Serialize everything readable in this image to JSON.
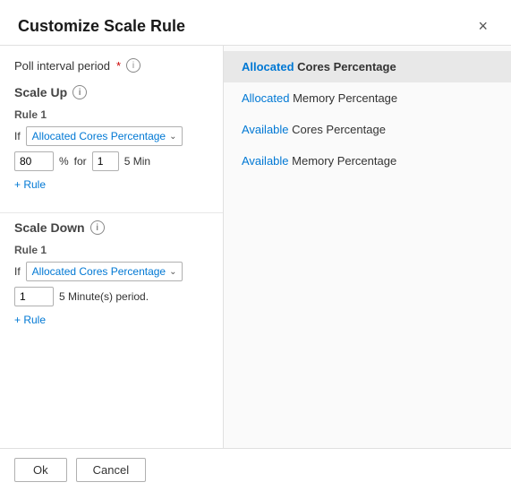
{
  "dialog": {
    "title": "Customize Scale Rule",
    "close_label": "×"
  },
  "poll_interval": {
    "label": "Poll interval period",
    "required": "*",
    "info": "i"
  },
  "scale_up": {
    "title": "Scale Up",
    "info": "i",
    "rule1": {
      "label": "Rule 1",
      "if_label": "If",
      "dropdown_value": "Allocated Cores Percentage",
      "chevron": "⌄",
      "input_value": "80",
      "pct_label": "%",
      "for_label": "for",
      "duration_value": "1",
      "min_label": "5 Min"
    },
    "add_rule_label": "+ Rule"
  },
  "scale_down": {
    "title": "Scale Down",
    "info": "i",
    "rule1": {
      "label": "Rule 1",
      "if_label": "If",
      "dropdown_value": "Allocated Cores Percentage",
      "chevron": "⌄",
      "input_value": "1",
      "period_label": "5 Minute(s) period."
    },
    "add_rule_label": "+ Rule"
  },
  "footer": {
    "ok_label": "Ok",
    "cancel_label": "Cancel"
  },
  "dropdown_options": [
    {
      "id": "allocated-cores",
      "label": "Allocated Cores Percentage",
      "selected": true,
      "highlight_word": "Allocated"
    },
    {
      "id": "allocated-memory",
      "label": "Allocated Memory Percentage",
      "selected": false,
      "highlight_word": "Allocated"
    },
    {
      "id": "available-cores",
      "label": "Available Cores Percentage",
      "selected": false,
      "highlight_word": "Available"
    },
    {
      "id": "available-memory",
      "label": "Available Memory Percentage",
      "selected": false,
      "highlight_word": "Available"
    }
  ]
}
